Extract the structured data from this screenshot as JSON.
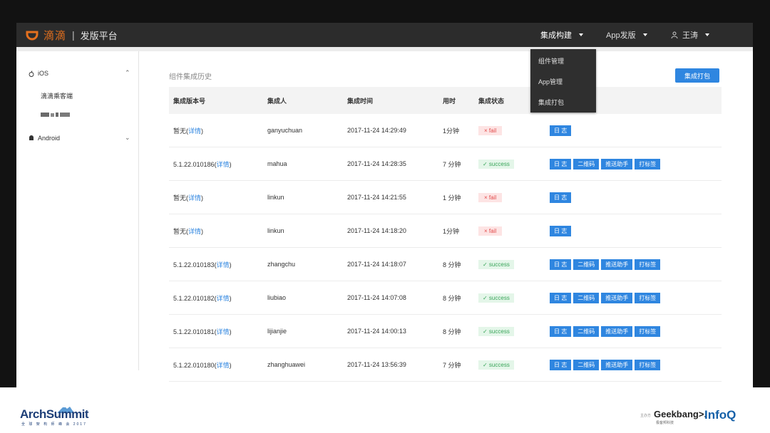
{
  "header": {
    "brand": "滴滴",
    "platform": "发版平台",
    "nav": [
      {
        "label": "集成构建",
        "expanded": true
      },
      {
        "label": "App发版"
      },
      {
        "label": "王涛"
      }
    ]
  },
  "dropdown": {
    "items": [
      "组件管理",
      "App管理",
      "集成打包"
    ]
  },
  "sidebar": {
    "sections": [
      {
        "label": "iOS",
        "icon": "apple-icon",
        "items": [
          "滴滴乘客端"
        ]
      },
      {
        "label": "Android",
        "icon": "android-icon"
      }
    ]
  },
  "main": {
    "title": "组件集成历史",
    "pack_button": "集成打包",
    "columns": [
      "集成版本号",
      "集成人",
      "集成时间",
      "用时",
      "集成状态"
    ],
    "detail_label": "详情",
    "op_labels": {
      "log": "日 志",
      "qrcode": "二维码",
      "assistant": "推送助手",
      "tag": "打标签"
    },
    "rows": [
      {
        "version": "暂无",
        "user": "ganyuchuan",
        "time": "2017-11-24 14:29:49",
        "duration": "1分钟",
        "status": "fail",
        "status_label": "× fail"
      },
      {
        "version": "5.1.22.010186",
        "user": "mahua",
        "time": "2017-11-24 14:28:35",
        "duration": "7 分钟",
        "status": "success",
        "status_label": "✓ success"
      },
      {
        "version": "暂无",
        "user": "linkun",
        "time": "2017-11-24 14:21:55",
        "duration": "1 分钟",
        "status": "fail",
        "status_label": "× fail"
      },
      {
        "version": "暂无",
        "user": "linkun",
        "time": "2017-11-24 14:18:20",
        "duration": "1分钟",
        "status": "fail",
        "status_label": "× fail"
      },
      {
        "version": "5.1.22.010183",
        "user": "zhangchu",
        "time": "2017-11-24 14:18:07",
        "duration": "8 分钟",
        "status": "success",
        "status_label": "✓ success"
      },
      {
        "version": "5.1.22.010182",
        "user": "liubiao",
        "time": "2017-11-24 14:07:08",
        "duration": "8 分钟",
        "status": "success",
        "status_label": "✓ success"
      },
      {
        "version": "5.1.22.010181",
        "user": "lijianjie",
        "time": "2017-11-24 14:00:13",
        "duration": "8 分钟",
        "status": "success",
        "status_label": "✓ success"
      },
      {
        "version": "5.1.22.010180",
        "user": "zhanghuawei",
        "time": "2017-11-24 13:56:39",
        "duration": "7 分钟",
        "status": "success",
        "status_label": "✓ success"
      }
    ]
  },
  "footer": {
    "left_logo": "ArchSummit",
    "left_sub": "全 球 架 构 师 峰 会 2017",
    "sponsor_label": "主办方",
    "geekbang": "Geekbang>.",
    "geekbang_sub": "极客邦科技",
    "infoq": "InfoQ"
  },
  "colors": {
    "accent": "#2f86e0",
    "brand_orange": "#e4701e",
    "topbar": "#2c2c2c",
    "fail": "#e34b4b",
    "success": "#3aa55a"
  }
}
